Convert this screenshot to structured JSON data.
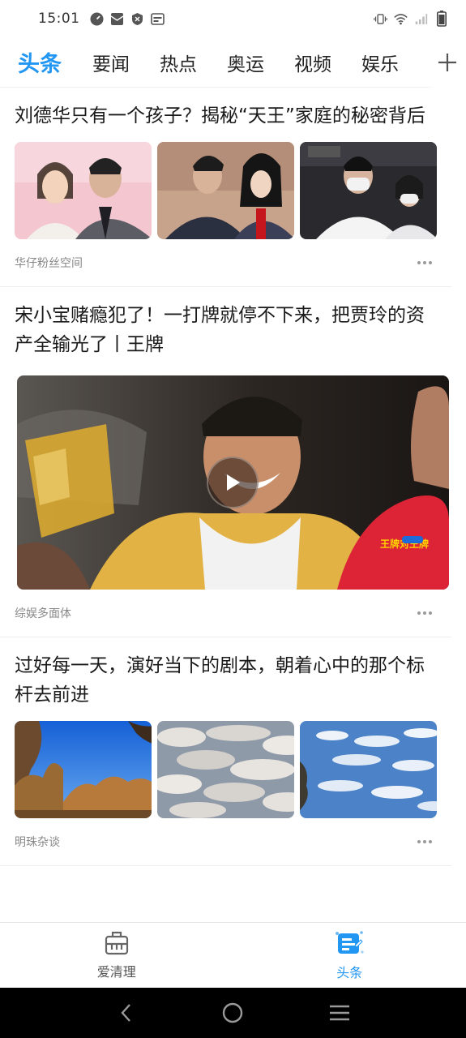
{
  "status_bar": {
    "time": "15:01",
    "left_icons": [
      "speed-icon",
      "mail-icon",
      "shield-icon",
      "calendar-icon"
    ],
    "right_icons": [
      "vibrate-icon",
      "wifi-icon",
      "signal-icon",
      "battery-icon"
    ]
  },
  "tabs": {
    "items": [
      "头条",
      "要闻",
      "热点",
      "奥运",
      "视频",
      "娱乐"
    ],
    "active_index": 0,
    "accent_color": "#2196F3"
  },
  "feed": {
    "articles": [
      {
        "title": "刘德华只有一个孩子？揭秘“天王”家庭的秘密背后",
        "source": "华仔粉丝空间",
        "type": "three-images"
      },
      {
        "title": "宋小宝赌瘾犯了！一打牌就停不下来，把贾玲的资产全输光了丨王牌",
        "source": "综娱多面体",
        "type": "video",
        "watermark": "王牌对王牌"
      },
      {
        "title": "过好每一天，演好当下的剧本，朝着心中的那个标杆去前进",
        "source": "明珠杂谈",
        "type": "three-images"
      }
    ]
  },
  "bottom_nav": {
    "items": [
      {
        "label": "爱清理",
        "icon": "cleaner-bag-icon"
      },
      {
        "label": "头条",
        "icon": "news-icon"
      }
    ],
    "active_index": 1
  },
  "system_nav": [
    "back-icon",
    "home-icon",
    "recents-icon"
  ]
}
